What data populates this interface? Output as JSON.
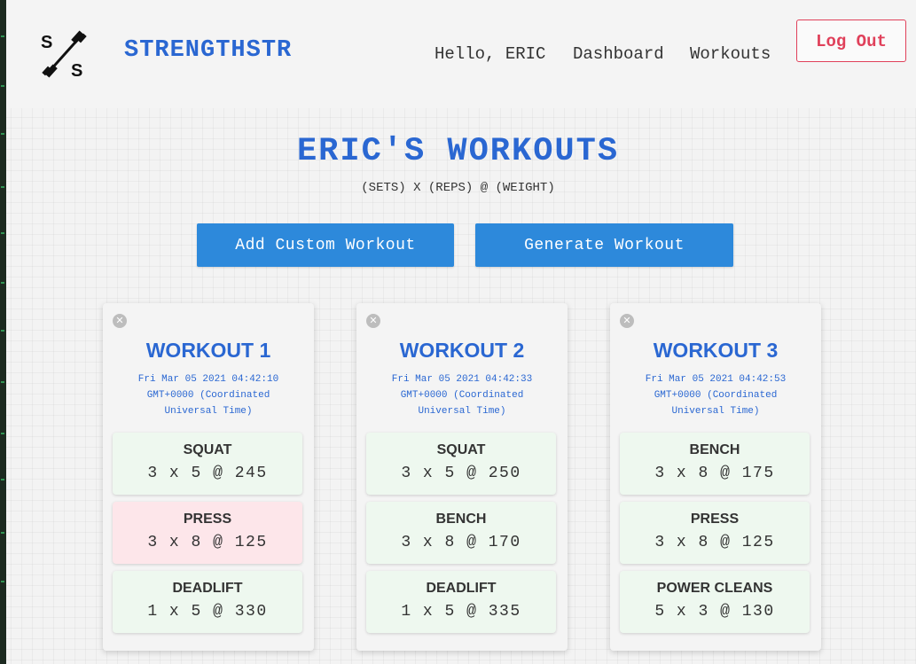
{
  "nav": {
    "brand": "STRENGTHSTR",
    "logo_letters": [
      "S",
      "S"
    ],
    "greeting": "Hello, ERIC",
    "dashboard": "Dashboard",
    "workouts": "Workouts",
    "logout": "Log Out"
  },
  "main": {
    "title": "ERIC'S WORKOUTS",
    "subtitle": "(SETS) X (REPS) @ (WEIGHT)",
    "add_button": "Add Custom Workout",
    "generate_button": "Generate Workout"
  },
  "workouts": [
    {
      "title": "WORKOUT 1",
      "date": "Fri Mar 05 2021 04:42:10 GMT+0000 (Coordinated Universal Time)",
      "exercises": [
        {
          "name": "SQUAT",
          "value": "3 x 5 @ 245",
          "status": "ok"
        },
        {
          "name": "PRESS",
          "value": "3 x 8 @ 125",
          "status": "warn"
        },
        {
          "name": "DEADLIFT",
          "value": "1 x 5 @ 330",
          "status": "ok"
        }
      ]
    },
    {
      "title": "WORKOUT 2",
      "date": "Fri Mar 05 2021 04:42:33 GMT+0000 (Coordinated Universal Time)",
      "exercises": [
        {
          "name": "SQUAT",
          "value": "3 x 5 @ 250",
          "status": "ok"
        },
        {
          "name": "BENCH",
          "value": "3 x 8 @ 170",
          "status": "ok"
        },
        {
          "name": "DEADLIFT",
          "value": "1 x 5 @ 335",
          "status": "ok"
        }
      ]
    },
    {
      "title": "WORKOUT 3",
      "date": "Fri Mar 05 2021 04:42:53 GMT+0000 (Coordinated Universal Time)",
      "exercises": [
        {
          "name": "BENCH",
          "value": "3 x 8 @ 175",
          "status": "ok"
        },
        {
          "name": "PRESS",
          "value": "3 x 8 @ 125",
          "status": "ok"
        },
        {
          "name": "POWER CLEANS",
          "value": "5 x 3 @ 130",
          "status": "ok"
        }
      ]
    }
  ],
  "colors": {
    "accent": "#2a67d2",
    "button": "#2d89db",
    "logout": "#e0405a",
    "exercise_ok": "#eef8ef",
    "exercise_warn": "#fde6ea"
  },
  "icons": {
    "logo": "dumbbell-icon",
    "delete": "close-icon"
  }
}
